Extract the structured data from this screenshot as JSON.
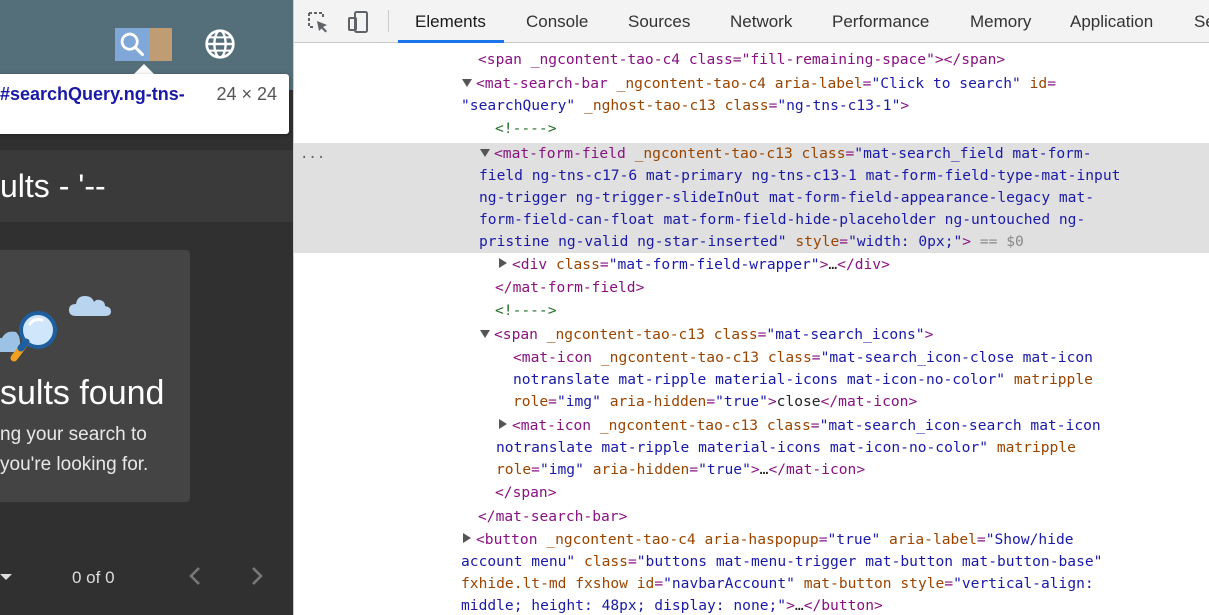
{
  "preview": {
    "tooltip": {
      "selector": "#searchQuery.ng-tns-",
      "size": "24 × 24"
    },
    "title": "ults - '--",
    "card": {
      "heading": "sults found",
      "hint_line1": "ng your search to",
      "hint_line2": "you're looking for."
    },
    "paginator": {
      "range": "0 of 0"
    },
    "icons": [
      "search-icon",
      "globe-icon",
      "cloud-icon",
      "magnifier-icon",
      "chevron-left-icon",
      "chevron-right-icon"
    ]
  },
  "devtools": {
    "tabs": [
      "Elements",
      "Console",
      "Sources",
      "Network",
      "Performance",
      "Memory",
      "Application",
      "Se"
    ],
    "active_tab": "Elements",
    "accent": "#1a73e8",
    "dots": "...",
    "lines": [
      {
        "indent": 0,
        "html": "[[t:<span ]][[a:_ngcontent-tao-c4 ]][[a:class]][[t:=]][[v:\"fill-remaining-space\"]][[t:></span>]]"
      },
      {
        "indent": 0,
        "tw": "open",
        "html": "[[t:<mat-search-bar ]][[a:_ngcontent-tao-c4 ]][[a:aria-label]][[t:=]][[v:\"Click to search\"]][[a: id]][[t:=]]"
      },
      {
        "indent": -1,
        "html": "[[v:\"searchQuery\"]][[a: _nghost-tao-c13 ]][[a:class]][[t:=]][[v:\"ng-tns-c13-1\"]][[t:>]]"
      }
    ],
    "dom": {
      "l1": "<span _ngcontent-tao-c4 class=\"fill-remaining-space\"></span>",
      "l2a": "<mat-search-bar",
      "l2b": "_ngcontent-tao-c4",
      "l2c": "aria-label",
      "l2d": "\"Click to search\"",
      "l2e": "id",
      "l3a": "\"searchQuery\"",
      "l3b": "_nghost-tao-c13",
      "l3c": "class",
      "l3d": "\"ng-tns-c13-1\"",
      "comment": "<!---->",
      "s1a": "<mat-form-field",
      "s1b": "_ngcontent-tao-c13",
      "s1c": "class",
      "s1d": "\"mat-search_field mat-form-",
      "s2": "field ng-tns-c17-6 mat-primary ng-tns-c13-1 mat-form-field-type-mat-input",
      "s3": "ng-trigger ng-trigger-slideInOut mat-form-field-appearance-legacy mat-",
      "s4": "form-field-can-float mat-form-field-hide-placeholder ng-untouched ng-",
      "s5a": "pristine ng-valid ng-star-inserted\"",
      "s5b": "style",
      "s5c": "\"width: 0px;\"",
      "s5d": "== $0",
      "w1a": "<div",
      "w1b": "class",
      "w1c": "\"mat-form-field-wrapper\"",
      "ellipsis": "…",
      "w1d": "</div>",
      "ff_close": "</mat-form-field>",
      "icons_a": "<span",
      "icons_b": "_ngcontent-tao-c13",
      "icons_c": "class",
      "icons_d": "\"mat-search_icons\"",
      "mi1a": "<mat-icon",
      "mi1b": "_ngcontent-tao-c13",
      "mi1c": "class",
      "mi1d": "\"mat-search_icon-close mat-icon",
      "mi1e": "notranslate mat-ripple material-icons mat-icon-no-color\"",
      "mi1f": "matripple",
      "mi1g": "role",
      "mi1h": "\"img\"",
      "mi1i": "aria-hidden",
      "mi1j": "\"true\"",
      "mi1k": "close",
      "mi1l": "</mat-icon>",
      "mi2d": "\"mat-search_icon-search mat-icon",
      "span_close": "</span>",
      "bar_close": "</mat-search-bar>",
      "b1a": "<button",
      "b1b": "_ngcontent-tao-c4",
      "b1c": "aria-haspopup",
      "b1d": "\"true\"",
      "b1e": "aria-label",
      "b1f": "\"Show/hide",
      "b2a": "account menu\"",
      "b2b": "class",
      "b2c": "\"buttons mat-menu-trigger mat-button mat-button-base\"",
      "b3a": "fxhide.lt-md fxshow",
      "b3b": "id",
      "b3c": "\"navbarAccount\"",
      "b3d": "mat-button",
      "b3e": "style",
      "b3f": "\"vertical-align:",
      "b4a": "middle; height: 48px; display: none;\"",
      "b4b": "</button>"
    }
  }
}
